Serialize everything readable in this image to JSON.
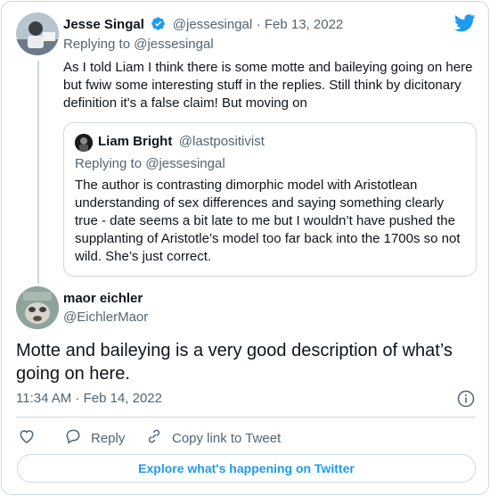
{
  "tweet1": {
    "name": "Jesse Singal",
    "handle": "@jessesingal",
    "date": "· Feb 13, 2022",
    "replying_to": "Replying to @jessesingal",
    "text": "As I told Liam I think there is some motte and baileying going on here but fwiw some interesting stuff in the replies. Still think by dicitonary definition it's a false claim! But moving on"
  },
  "quote": {
    "name": "Liam Bright",
    "handle": "@lastpositivist",
    "replying_to": "Replying to @jessesingal",
    "text": "The author is contrasting dimorphic model with Aristotlean understanding of sex differences and saying something clearly true - date seems a bit late to me but I wouldn’t have pushed the supplanting of Aristotle’s model too far back into the 1700s so not wild. She’s just correct."
  },
  "tweet2": {
    "name": "maor eichler",
    "handle": "@EichlerMaor",
    "text": "Motte and baileying is a very good description of what’s going on here.",
    "timestamp": "11:34 AM · Feb 14, 2022"
  },
  "actions": {
    "reply": "Reply",
    "copy_link": "Copy link to Tweet"
  },
  "explore_label": "Explore what's happening on Twitter",
  "colors": {
    "twitter_blue": "#1d9bf0",
    "muted": "#536471",
    "border": "#cfd9de"
  },
  "icons": [
    "twitter-bird-icon",
    "verified-badge-icon",
    "info-icon",
    "heart-icon",
    "reply-icon",
    "link-icon"
  ]
}
